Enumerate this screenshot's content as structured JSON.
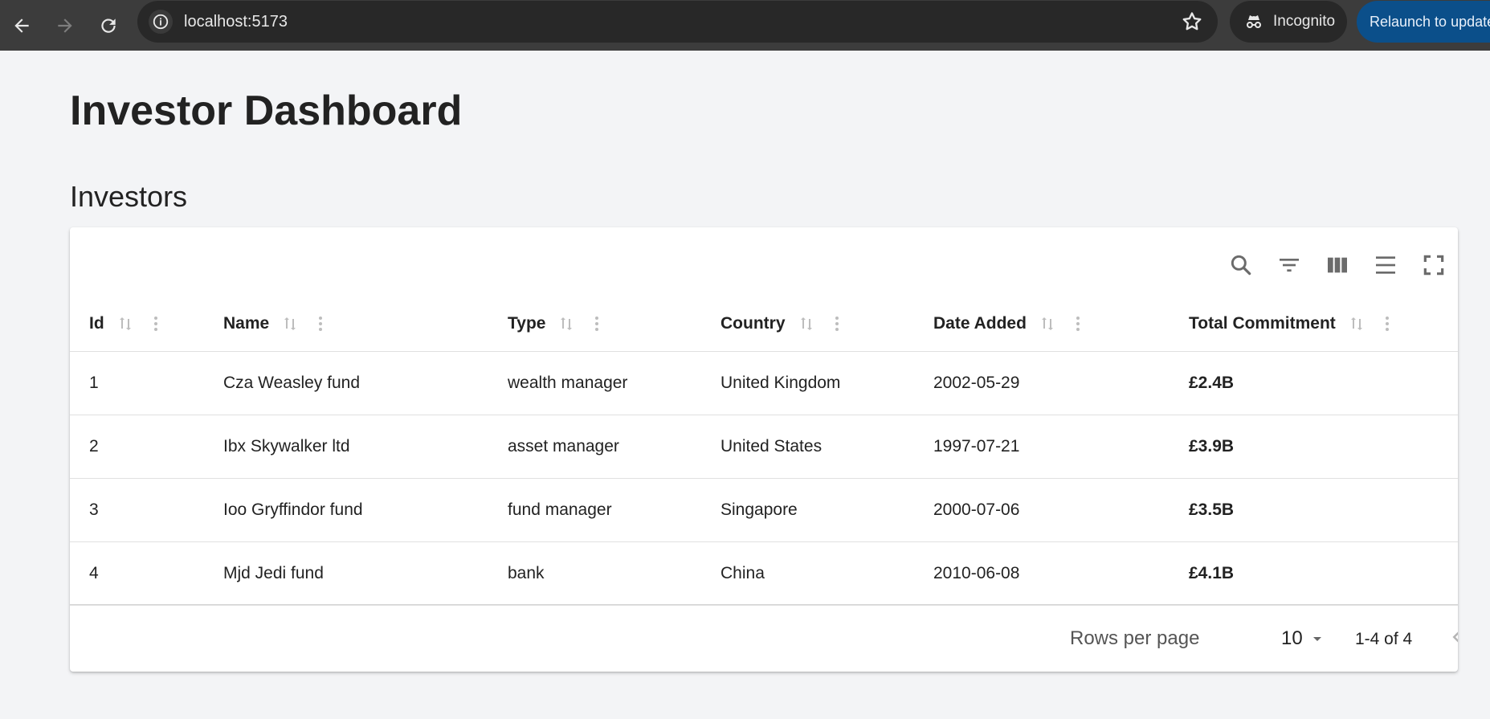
{
  "browser": {
    "url": "localhost:5173",
    "incognito_label": "Incognito",
    "relaunch_label": "Relaunch to update"
  },
  "page": {
    "title": "Investor Dashboard",
    "section_title": "Investors"
  },
  "table": {
    "toolbar_icons": [
      "search-icon",
      "filter-icon",
      "columns-icon",
      "density-icon",
      "fullscreen-icon"
    ],
    "columns": [
      "Id",
      "Name",
      "Type",
      "Country",
      "Date Added",
      "Total Commitment"
    ],
    "rows": [
      [
        "1",
        "Cza Weasley fund",
        "wealth manager",
        "United Kingdom",
        "2002-05-29",
        "£2.4B"
      ],
      [
        "2",
        "Ibx Skywalker ltd",
        "asset manager",
        "United States",
        "1997-07-21",
        "£3.9B"
      ],
      [
        "3",
        "Ioo Gryffindor fund",
        "fund manager",
        "Singapore",
        "2000-07-06",
        "£3.5B"
      ],
      [
        "4",
        "Mjd Jedi fund",
        "bank",
        "China",
        "2010-06-08",
        "£4.1B"
      ]
    ],
    "pagination": {
      "rows_per_page_label": "Rows per page",
      "rows_per_page_value": "10",
      "range_text": "1-4 of 4"
    }
  },
  "colors": {
    "page_background": "#f3f4f6",
    "browser_chrome": "#3c3c3c",
    "relaunch_button": "#0b4f8a"
  }
}
